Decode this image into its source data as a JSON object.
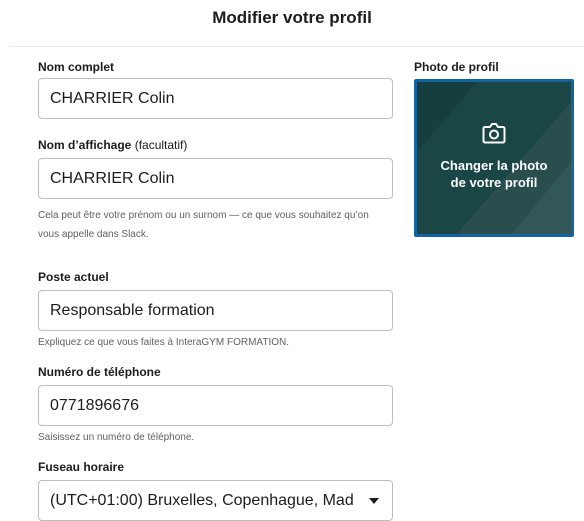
{
  "header": {
    "title": "Modifier votre profil"
  },
  "form": {
    "full_name": {
      "label": "Nom complet",
      "value": "CHARRIER Colin"
    },
    "display_name": {
      "label": "Nom d’affichage",
      "optional": "(facultatif)",
      "value": "CHARRIER Colin",
      "hint": "Cela peut être votre prénom ou un surnom — ce que vous souhaitez qu’on vous appelle dans Slack."
    },
    "job_title": {
      "label": "Poste actuel",
      "value": "Responsable formation",
      "hint": "Expliquez ce que vous faites à InteraGYM FORMATION."
    },
    "phone": {
      "label": "Numéro de téléphone",
      "value": "0771896676",
      "hint": "Saisissez un numéro de téléphone."
    },
    "timezone": {
      "label": "Fuseau horaire",
      "value": "(UTC+01:00) Bruxelles, Copenhague, Mad"
    }
  },
  "photo": {
    "label": "Photo de profil",
    "button_text": "Changer la photo de votre profil",
    "icon": "camera-icon"
  },
  "colors": {
    "accent": "#1264a3",
    "photo_bg": "#1a4646",
    "text": "#1d1c1d",
    "hint": "#616061",
    "border": "#bdbdbd"
  }
}
